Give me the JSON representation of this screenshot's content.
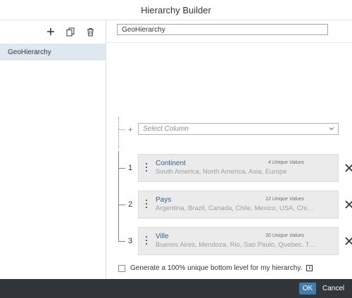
{
  "dialog": {
    "title": "Hierarchy Builder"
  },
  "toolbar": {
    "add_icon": "plus-icon",
    "copy_icon": "copy-icon",
    "delete_icon": "trash-icon"
  },
  "hierarchies": [
    {
      "name": "GeoHierarchy",
      "selected": true
    }
  ],
  "editor": {
    "name_value": "GeoHierarchy",
    "add_symbol": "+",
    "select_column_placeholder": "Select Column",
    "levels": [
      {
        "number": "1",
        "name": "Continent",
        "count": "4 Unique Values",
        "values": "South America, North America, Asia, Europe"
      },
      {
        "number": "2",
        "name": "Pays",
        "count": "12 Unique Values",
        "values": "Argentina, Brazil, Canada, Chile, Mexico, USA, China, India, Japan"
      },
      {
        "number": "3",
        "name": "Ville",
        "count": "30 Unique Values",
        "values": "Buenos Aires, Mendoza, Rio, Sao Paulo, Quebec, Toronto, Santiago"
      }
    ],
    "unique_checkbox_label": "Generate a 100% unique bottom level for my hierarchy.",
    "unique_checked": false,
    "info_symbol": "i"
  },
  "footer": {
    "ok_label": "OK",
    "cancel_label": "Cancel"
  },
  "colors": {
    "accent": "#427cac",
    "footer_bg": "#32363a",
    "selected_bg": "#dfe7ef",
    "level_name": "#346187"
  }
}
